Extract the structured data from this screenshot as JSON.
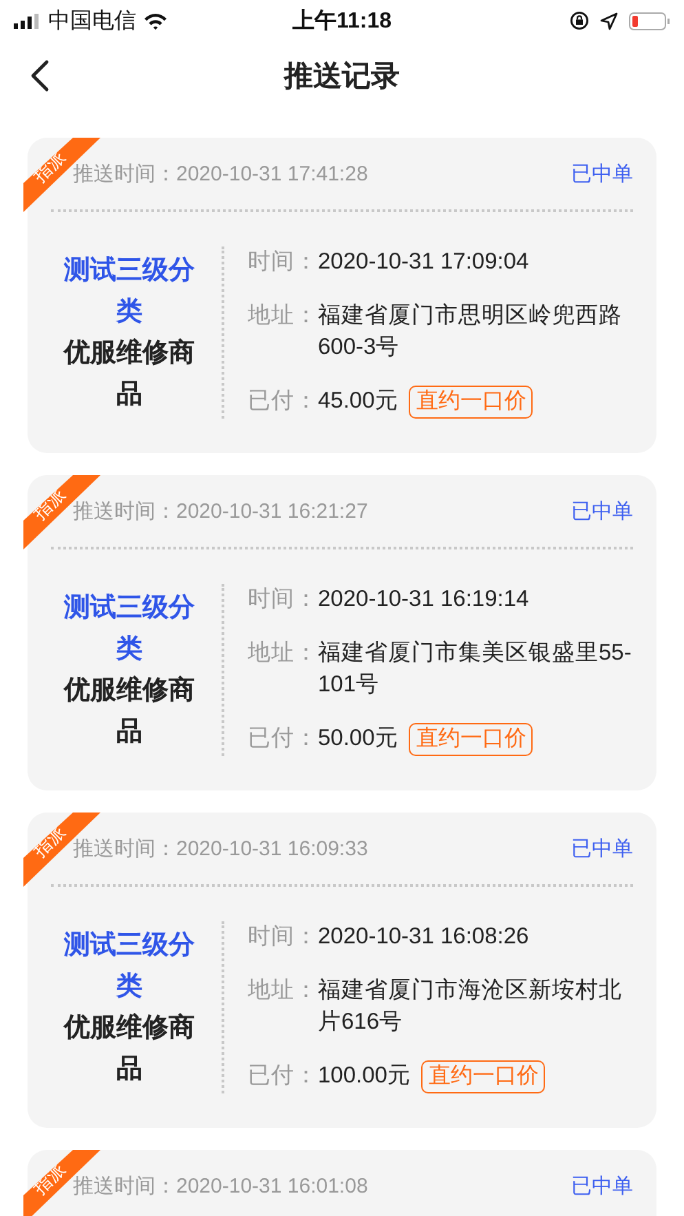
{
  "status_bar": {
    "carrier": "中国电信",
    "time": "上午11:18"
  },
  "nav": {
    "title": "推送记录"
  },
  "records": [
    {
      "tag": "指派",
      "push_label": "推送时间：",
      "push_time": "2020-10-31 17:41:28",
      "status": "已中单",
      "category": "测试三级分类",
      "service": "优服维修商品",
      "fields": [
        {
          "kind": "text",
          "label": "时间：",
          "value": "2020-10-31 17:09:04"
        },
        {
          "kind": "text",
          "label": "地址：",
          "value": "福建省厦门市思明区岭兜西路600-3号"
        },
        {
          "kind": "price",
          "label": "已付：",
          "value": "45.00元",
          "badge": "直约一口价"
        }
      ]
    },
    {
      "tag": "指派",
      "push_label": "推送时间：",
      "push_time": "2020-10-31 16:21:27",
      "status": "已中单",
      "category": "测试三级分类",
      "service": "优服维修商品",
      "fields": [
        {
          "kind": "text",
          "label": "时间：",
          "value": "2020-10-31 16:19:14"
        },
        {
          "kind": "text",
          "label": "地址：",
          "value": "福建省厦门市集美区银盛里55-101号"
        },
        {
          "kind": "price",
          "label": "已付：",
          "value": "50.00元",
          "badge": "直约一口价"
        }
      ]
    },
    {
      "tag": "指派",
      "push_label": "推送时间：",
      "push_time": "2020-10-31 16:09:33",
      "status": "已中单",
      "category": "测试三级分类",
      "service": "优服维修商品",
      "fields": [
        {
          "kind": "text",
          "label": "时间：",
          "value": "2020-10-31 16:08:26"
        },
        {
          "kind": "text",
          "label": "地址：",
          "value": "福建省厦门市海沧区新垵村北片616号"
        },
        {
          "kind": "price",
          "label": "已付：",
          "value": "100.00元",
          "badge": "直约一口价"
        }
      ]
    },
    {
      "tag": "指派",
      "push_label": "推送时间：",
      "push_time": "2020-10-31 16:01:08",
      "status": "已中单"
    }
  ]
}
